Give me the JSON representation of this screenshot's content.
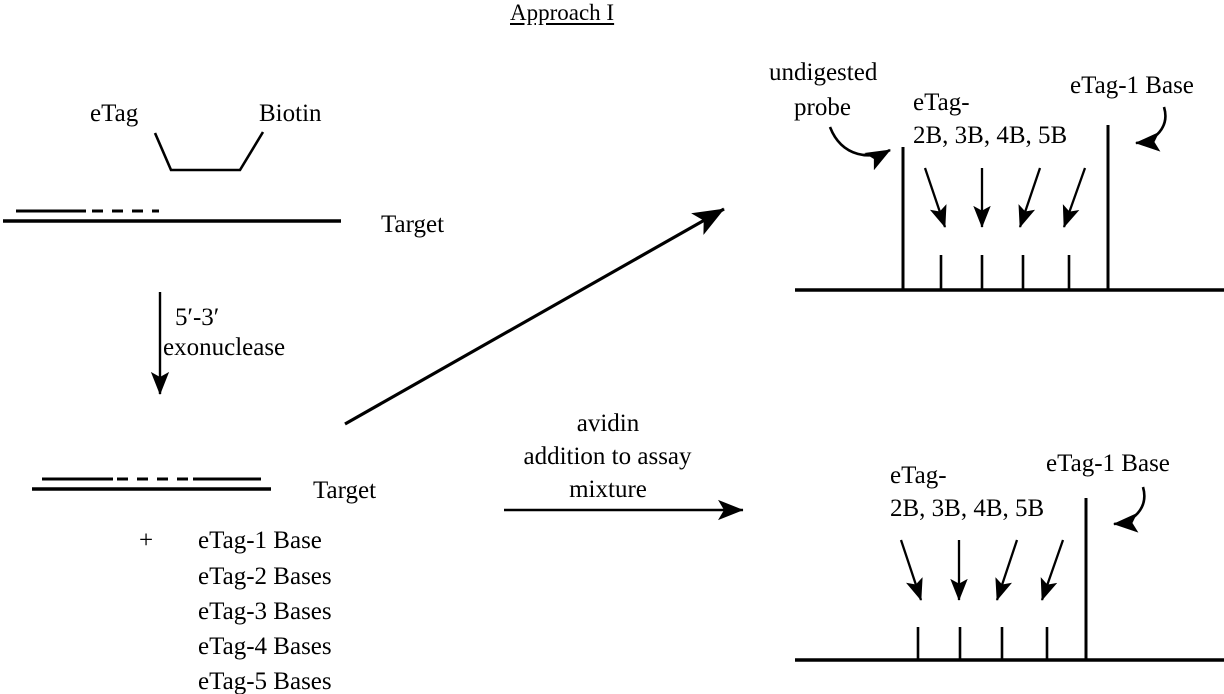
{
  "title": "Approach I",
  "left_panel": {
    "probe": {
      "etag_label": "eTag",
      "biotin_label": "Biotin",
      "target_label": "Target"
    },
    "reaction_arrow": {
      "line1": "5′-3′",
      "line2": "exonuclease"
    },
    "products": {
      "target_label": "Target",
      "plus_sign": "+",
      "items": [
        "eTag-1 Base",
        "eTag-2 Bases",
        "eTag-3 Bases",
        "eTag-4 Bases",
        "eTag-5 Bases"
      ]
    }
  },
  "avidin_arrow": {
    "line1": "avidin",
    "line2": "addition to assay",
    "line3": "mixture"
  },
  "top_trace": {
    "undigested_label_line1": "undigested",
    "undigested_label_line2": "probe",
    "etag_multi_line1": "eTag-",
    "etag_multi_line2": "2B, 3B, 4B, 5B",
    "etag1_label": "eTag-1 Base"
  },
  "bottom_trace": {
    "etag_multi_line1": "eTag-",
    "etag_multi_line2": "2B, 3B, 4B, 5B",
    "etag1_label": "eTag-1 Base"
  },
  "chart_data": [
    {
      "type": "bar",
      "name": "top-electropherogram",
      "title": "",
      "categories": [
        "undigested probe",
        "eTag-2B",
        "eTag-3B",
        "eTag-4B",
        "eTag-5B",
        "eTag-1 Base"
      ],
      "values": [
        100,
        22,
        22,
        22,
        22,
        100
      ],
      "xlabel": "",
      "ylabel": "",
      "grid": false,
      "annotations": [
        "undigested probe",
        "eTag-2B, 3B, 4B, 5B",
        "eTag-1 Base"
      ]
    },
    {
      "type": "bar",
      "name": "bottom-electropherogram",
      "title": "",
      "categories": [
        "eTag-2B",
        "eTag-3B",
        "eTag-4B",
        "eTag-5B",
        "eTag-1 Base"
      ],
      "values": [
        22,
        22,
        22,
        22,
        100
      ],
      "xlabel": "",
      "ylabel": "",
      "grid": false,
      "annotations": [
        "eTag-2B, 3B, 4B, 5B",
        "eTag-1 Base"
      ]
    }
  ],
  "colors": {
    "ink": "#000000",
    "background": "#ffffff"
  }
}
